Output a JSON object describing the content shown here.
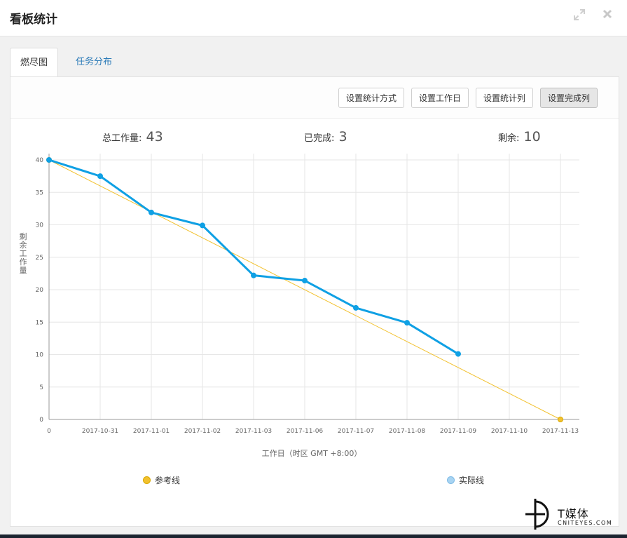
{
  "dialog": {
    "title": "看板统计",
    "expand_icon": "expand-icon",
    "close_icon": "close-icon"
  },
  "tabs": [
    {
      "label": "燃尽图",
      "active": true
    },
    {
      "label": "任务分布",
      "active": false
    }
  ],
  "toolbar": {
    "buttons": [
      {
        "label": "设置统计方式"
      },
      {
        "label": "设置工作日"
      },
      {
        "label": "设置统计列"
      },
      {
        "label": "设置完成列",
        "active": true
      }
    ]
  },
  "stats": {
    "total_label": "总工作量:",
    "total_value": "43",
    "done_label": "已完成:",
    "done_value": "3",
    "remain_label": "剩余:",
    "remain_value": "10"
  },
  "chart_data": {
    "type": "line",
    "categories": [
      "0",
      "2017-10-31",
      "2017-11-01",
      "2017-11-02",
      "2017-11-03",
      "2017-11-06",
      "2017-11-07",
      "2017-11-08",
      "2017-11-09",
      "2017-11-10",
      "2017-11-13"
    ],
    "ylabel": "剩余工作量",
    "xlabel": "工作日（时区 GMT +8:00）",
    "ylim": [
      0,
      40
    ],
    "yticks": [
      0,
      5,
      10,
      15,
      20,
      25,
      30,
      35,
      40
    ],
    "grid": true,
    "legend_position": "bottom",
    "series": [
      {
        "name": "参考线",
        "color": "#f2c12e",
        "values": [
          40,
          null,
          null,
          null,
          null,
          null,
          null,
          null,
          null,
          null,
          0
        ]
      },
      {
        "name": "实际线",
        "color": "#0fa0e4",
        "values": [
          40,
          37.5,
          31.9,
          29.9,
          22.2,
          21.4,
          17.2,
          14.9,
          10.1,
          null,
          null
        ]
      }
    ]
  },
  "legend_dots": {
    "reference_color": "#f2c12e",
    "actual_color": "#a8d4f2"
  },
  "watermark": {
    "logo": "tmedia-logo",
    "text": "T媒体",
    "subtext": "CNITEYES.COM"
  }
}
